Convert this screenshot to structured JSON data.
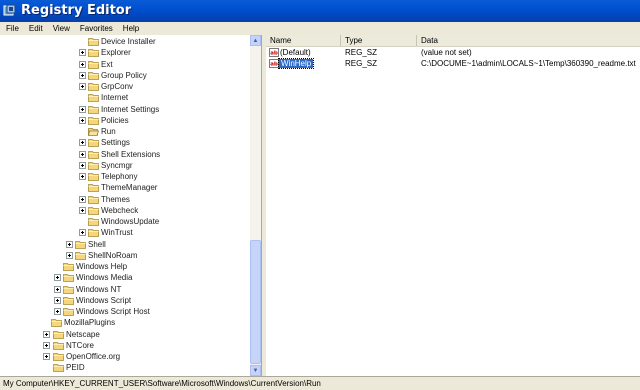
{
  "window": {
    "title": "Registry Editor"
  },
  "menu": [
    "File",
    "Edit",
    "View",
    "Favorites",
    "Help"
  ],
  "tree": [
    {
      "label": "Device Installer",
      "expander": false
    },
    {
      "label": "Explorer",
      "expander": true
    },
    {
      "label": "Ext",
      "expander": true
    },
    {
      "label": "Group Policy",
      "expander": true
    },
    {
      "label": "GrpConv",
      "expander": true
    },
    {
      "label": "Internet",
      "expander": false
    },
    {
      "label": "Internet Settings",
      "expander": true
    },
    {
      "label": "Policies",
      "expander": true
    },
    {
      "label": "Run",
      "expander": false,
      "open": true
    },
    {
      "label": "Settings",
      "expander": true
    },
    {
      "label": "Shell Extensions",
      "expander": true
    },
    {
      "label": "Syncmgr",
      "expander": true
    },
    {
      "label": "Telephony",
      "expander": true
    },
    {
      "label": "ThemeManager",
      "expander": false
    },
    {
      "label": "Themes",
      "expander": true
    },
    {
      "label": "Webcheck",
      "expander": true
    },
    {
      "label": "WindowsUpdate",
      "expander": false
    },
    {
      "label": "WinTrust",
      "expander": true
    },
    {
      "label": "Shell",
      "expander": true
    },
    {
      "label": "ShellNoRoam",
      "expander": true
    },
    {
      "label": "Windows Help",
      "expander": false
    },
    {
      "label": "Windows Media",
      "expander": true
    },
    {
      "label": "Windows NT",
      "expander": true
    },
    {
      "label": "Windows Script",
      "expander": true
    },
    {
      "label": "Windows Script Host",
      "expander": true
    },
    {
      "label": "MozillaPlugins",
      "expander": false
    },
    {
      "label": "Netscape",
      "expander": true
    },
    {
      "label": "NTCore",
      "expander": true
    },
    {
      "label": "OpenOffice.org",
      "expander": true
    },
    {
      "label": "PEID",
      "expander": false
    }
  ],
  "list": {
    "columns": [
      "Name",
      "Type",
      "Data"
    ],
    "rows": [
      {
        "name": "(Default)",
        "type": "REG_SZ",
        "data": "(value not set)",
        "selected": false
      },
      {
        "name": "WinHelp",
        "type": "REG_SZ",
        "data": "C:\\DOCUME~1\\admin\\LOCALS~1\\Temp\\360390_readme.txt",
        "selected": true
      }
    ]
  },
  "status": {
    "path": "My Computer\\HKEY_CURRENT_USER\\Software\\Microsoft\\Windows\\CurrentVersion\\Run"
  },
  "colors": {
    "titlebar": "#0050d0",
    "selection": "#316ac5",
    "folder": "#f4d77d"
  }
}
